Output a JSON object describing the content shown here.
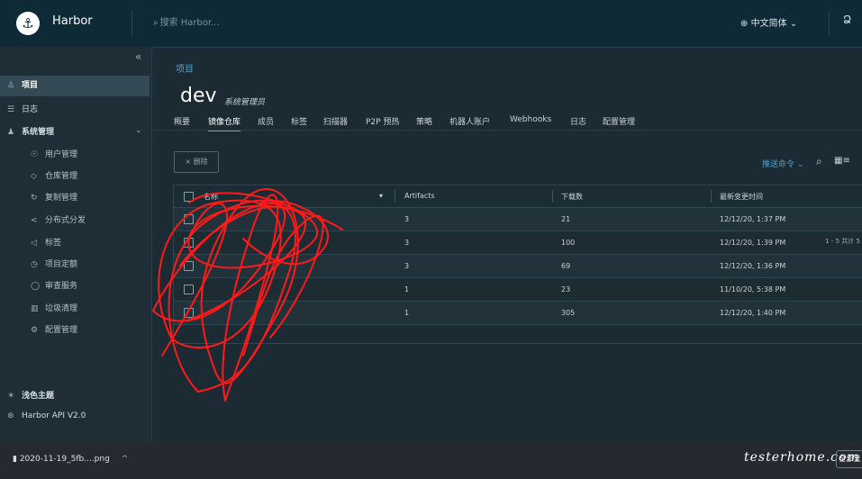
{
  "header": {
    "brand": "Harbor",
    "logo_glyph": "⚓",
    "search_placeholder": "搜索 Harbor...",
    "language": "中文简体",
    "language_chevron": "⌄",
    "user_glyph": "Ձ"
  },
  "sidebar": {
    "collapse_glyph": "«",
    "items": [
      {
        "label": "项目",
        "icon": "people-icon"
      },
      {
        "label": "日志",
        "icon": "list-icon"
      },
      {
        "label": "系统管理",
        "icon": "admin-icon"
      },
      {
        "label": "用户管理",
        "icon": "users-icon"
      },
      {
        "label": "仓库管理",
        "icon": "box-icon"
      },
      {
        "label": "复制管理",
        "icon": "sync-icon"
      },
      {
        "label": "分布式分发",
        "icon": "share-icon"
      },
      {
        "label": "标签",
        "icon": "tag-icon"
      },
      {
        "label": "项目定额",
        "icon": "quota-icon"
      },
      {
        "label": "审查服务",
        "icon": "shield-icon"
      },
      {
        "label": "垃圾清理",
        "icon": "trash-icon"
      },
      {
        "label": "配置管理",
        "icon": "gear-icon"
      }
    ],
    "theme": "浅色主题",
    "api": "Harbor API V2.0"
  },
  "main": {
    "breadcrumb": "项目",
    "project_name": "dev",
    "role": "系统管理员",
    "tabs": [
      "概要",
      "镜像仓库",
      "成员",
      "标签",
      "扫描器",
      "P2P 预热",
      "策略",
      "机器人账户",
      "Webhooks",
      "日志",
      "配置管理"
    ],
    "active_tab": "镜像仓库",
    "delete_label": "× 删除",
    "push_command": "推送命令",
    "table": {
      "headers": [
        "名称",
        "Artifacts",
        "下载数",
        "最新变更时间"
      ],
      "rows": [
        {
          "artifacts": "3",
          "pulls": "21",
          "updated": "12/12/20, 1:37 PM"
        },
        {
          "artifacts": "3",
          "pulls": "100",
          "updated": "12/12/20, 1:39 PM"
        },
        {
          "artifacts": "3",
          "pulls": "69",
          "updated": "12/12/20, 1:36 PM"
        },
        {
          "artifacts": "1",
          "pulls": "23",
          "updated": "11/10/20, 5:38 PM"
        },
        {
          "artifacts": "1",
          "pulls": "305",
          "updated": "12/12/20, 1:40 PM"
        }
      ],
      "footer": "1 - 5 共计 5"
    }
  },
  "taskbar": {
    "download_file": "2020-11-19_5fb....png",
    "download_chevron": "^",
    "watermark": "testerhome.com",
    "show_all": "全部显示"
  },
  "colors": {
    "accent": "#4aa5d9",
    "scribble": "#ff1a1a"
  }
}
